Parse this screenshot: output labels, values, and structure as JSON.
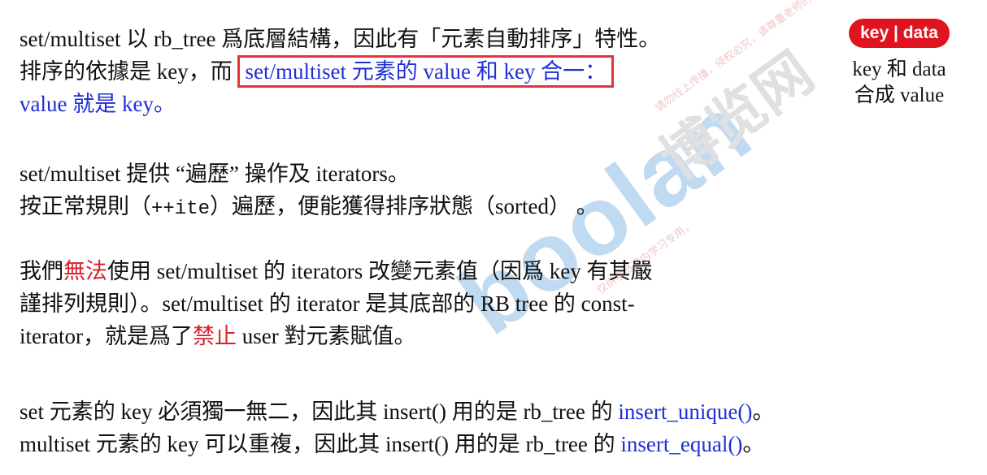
{
  "paragraph1": {
    "line1": "set/multiset 以 rb_tree 爲底層結構，因此有「元素自動排序」特性。",
    "line2_plain": "排序的依據是 key，而 ",
    "line2_highlight": "set/multiset 元素的 value 和 key 合一：",
    "line3": "value 就是 key。"
  },
  "badge": {
    "text": "key | data",
    "color": "#e0141e"
  },
  "side_note": {
    "line1": "key 和 data",
    "line2": "合成 value"
  },
  "paragraph2": {
    "line1": "set/multiset 提供 “遍歷” 操作及 iterators。",
    "line2_pre": "按正常規則（",
    "line2_code": "++ite",
    "line2_post": "）遍歷，便能獲得排序狀態（sorted） 。"
  },
  "paragraph3": {
    "line1_pre": "我們",
    "line1_red": "無法",
    "line1_post": "使用 set/multiset 的 iterators 改變元素值（因爲 key 有其嚴",
    "line2": "謹排列規則）。set/multiset 的 iterator 是其底部的 RB tree 的 const-",
    "line3_pre": "iterator，就是爲了",
    "line3_red": "禁止",
    "line3_post": " user 對元素賦值。"
  },
  "paragraph4": {
    "line1_pre": "set 元素的 key 必須獨一無二，因此其 insert() 用的是 rb_tree 的 ",
    "line1_fn": "insert_unique()",
    "line1_post": "。",
    "line2_pre": "multiset 元素的 key 可以重複，因此其 insert() 用的是 rb_tree 的 ",
    "line2_fn": "insert_equal()",
    "line2_post": "。"
  },
  "watermark": {
    "brand": "boolan",
    "cn": "博览网",
    "note1": "请勿线上传播，侵权必究，请尊重老师的著作权与智财权。",
    "note2": "仅供学员课内学习专用，"
  },
  "colors": {
    "blue_text": "#1f2fd6",
    "red_text": "#d8202a",
    "highlight_border": "#e8313b",
    "watermark_blue": "#3d8fd9"
  }
}
